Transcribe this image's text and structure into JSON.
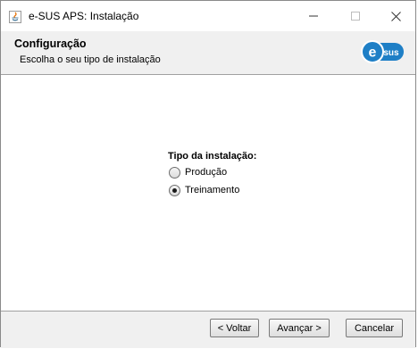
{
  "window": {
    "title": "e-SUS APS: Instalação",
    "controls": [
      "minimize-icon",
      "maximize-icon",
      "close-icon"
    ]
  },
  "header": {
    "title": "Configuração",
    "subtitle": "Escolha o seu tipo de instalação",
    "logo_text": "esus"
  },
  "install_type": {
    "label": "Tipo da instalação:",
    "options": [
      {
        "label": "Produção",
        "selected": false
      },
      {
        "label": "Treinamento",
        "selected": true
      }
    ]
  },
  "footer": {
    "back_label": "< Voltar",
    "next_label": "Avançar >",
    "cancel_label": "Cancelar"
  },
  "colors": {
    "logo_blue": "#1e7fc6",
    "window_bg": "#f0f0f0",
    "content_bg": "#ffffff"
  }
}
